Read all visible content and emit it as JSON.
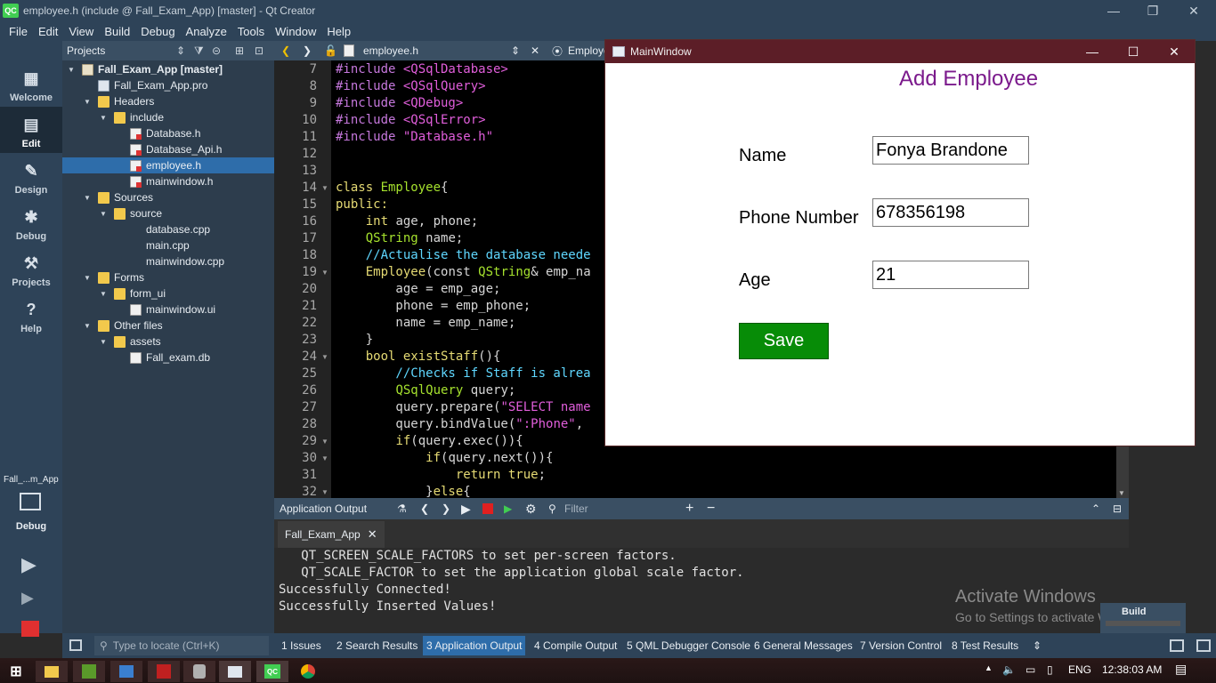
{
  "window": {
    "title": "employee.h (include @ Fall_Exam_App) [master] - Qt Creator",
    "logo": "QC"
  },
  "menu": [
    "File",
    "Edit",
    "View",
    "Build",
    "Debug",
    "Analyze",
    "Tools",
    "Window",
    "Help"
  ],
  "modes": [
    {
      "label": "Welcome",
      "icon": "grid-icon"
    },
    {
      "label": "Edit",
      "icon": "edit-icon"
    },
    {
      "label": "Design",
      "icon": "pen-icon"
    },
    {
      "label": "Debug",
      "icon": "bug-icon"
    },
    {
      "label": "Projects",
      "icon": "wrench-icon"
    },
    {
      "label": "Help",
      "icon": "help-icon"
    }
  ],
  "kit": {
    "project": "Fall_...m_App",
    "mode": "Debug"
  },
  "projects_pane": {
    "title": "Projects",
    "tree": [
      {
        "label": "Fall_Exam_App [master]",
        "type": "proj",
        "arrow": "▼",
        "bold": true
      },
      {
        "label": "Fall_Exam_App.pro",
        "type": "pro",
        "arrow": ""
      },
      {
        "label": "Headers",
        "type": "folder",
        "arrow": "▼"
      },
      {
        "label": "include",
        "type": "folder",
        "arrow": "▼"
      },
      {
        "label": "Database.h",
        "type": "h",
        "arrow": ""
      },
      {
        "label": "Database_Api.h",
        "type": "h",
        "arrow": ""
      },
      {
        "label": "employee.h",
        "type": "h",
        "arrow": "",
        "selected": true
      },
      {
        "label": "mainwindow.h",
        "type": "h",
        "arrow": ""
      },
      {
        "label": "Sources",
        "type": "src",
        "arrow": "▼"
      },
      {
        "label": "source",
        "type": "folder",
        "arrow": "▼"
      },
      {
        "label": "database.cpp",
        "type": "cpp",
        "arrow": ""
      },
      {
        "label": "main.cpp",
        "type": "cpp",
        "arrow": ""
      },
      {
        "label": "mainwindow.cpp",
        "type": "cpp",
        "arrow": ""
      },
      {
        "label": "Forms",
        "type": "forms",
        "arrow": "▼"
      },
      {
        "label": "form_ui",
        "type": "folder",
        "arrow": "▼"
      },
      {
        "label": "mainwindow.ui",
        "type": "ui",
        "arrow": ""
      },
      {
        "label": "Other files",
        "type": "other",
        "arrow": "▼"
      },
      {
        "label": "assets",
        "type": "folder",
        "arrow": "▼"
      },
      {
        "label": "Fall_exam.db",
        "type": "db",
        "arrow": ""
      }
    ]
  },
  "editor": {
    "file": "employee.h",
    "symbol": "Employe",
    "lines": [
      {
        "n": "7",
        "fold": "",
        "seg": [
          [
            "#include ",
            "#c678dd"
          ],
          [
            "<QSqlDatabase>",
            "#e15edb"
          ]
        ]
      },
      {
        "n": "8",
        "fold": "",
        "seg": [
          [
            "#include ",
            "#c678dd"
          ],
          [
            "<QSqlQuery>",
            "#e15edb"
          ]
        ]
      },
      {
        "n": "9",
        "fold": "",
        "seg": [
          [
            "#include ",
            "#c678dd"
          ],
          [
            "<QDebug>",
            "#e15edb"
          ]
        ]
      },
      {
        "n": "10",
        "fold": "",
        "seg": [
          [
            "#include ",
            "#c678dd"
          ],
          [
            "<QSqlError>",
            "#e15edb"
          ]
        ]
      },
      {
        "n": "11",
        "fold": "",
        "seg": [
          [
            "#include ",
            "#c678dd"
          ],
          [
            "\"Database.h\"",
            "#e15edb"
          ]
        ]
      },
      {
        "n": "12",
        "fold": "",
        "seg": []
      },
      {
        "n": "13",
        "fold": "",
        "seg": []
      },
      {
        "n": "14",
        "fold": "▼",
        "seg": [
          [
            "class ",
            "#e6db74"
          ],
          [
            "Employee",
            "#a6e22e"
          ],
          [
            "{",
            "#d6d6d6"
          ]
        ]
      },
      {
        "n": "15",
        "fold": "",
        "seg": [
          [
            "public:",
            "#e6db74"
          ]
        ]
      },
      {
        "n": "16",
        "fold": "",
        "seg": [
          [
            "    ",
            "#d6d6d6"
          ],
          [
            "int ",
            "#e6db74"
          ],
          [
            "age, phone;",
            "#d6d6d6"
          ]
        ]
      },
      {
        "n": "17",
        "fold": "",
        "seg": [
          [
            "    ",
            "#d6d6d6"
          ],
          [
            "QString ",
            "#a6e22e"
          ],
          [
            "name;",
            "#d6d6d6"
          ]
        ]
      },
      {
        "n": "18",
        "fold": "",
        "seg": [
          [
            "    //Actualise the database neede",
            "#5fd7ff"
          ]
        ]
      },
      {
        "n": "19",
        "fold": "▼",
        "seg": [
          [
            "    ",
            "#d6d6d6"
          ],
          [
            "Employee",
            "#e6db74"
          ],
          [
            "(const ",
            "#d6d6d6"
          ],
          [
            "QString",
            "#a6e22e"
          ],
          [
            "& emp_na",
            "#d6d6d6"
          ]
        ]
      },
      {
        "n": "20",
        "fold": "",
        "seg": [
          [
            "        age = emp_age;",
            "#d6d6d6"
          ]
        ]
      },
      {
        "n": "21",
        "fold": "",
        "seg": [
          [
            "        phone = emp_phone;",
            "#d6d6d6"
          ]
        ]
      },
      {
        "n": "22",
        "fold": "",
        "seg": [
          [
            "        name = emp_name;",
            "#d6d6d6"
          ]
        ]
      },
      {
        "n": "23",
        "fold": "",
        "seg": [
          [
            "    }",
            "#d6d6d6"
          ]
        ]
      },
      {
        "n": "24",
        "fold": "▼",
        "seg": [
          [
            "    ",
            "#d6d6d6"
          ],
          [
            "bool ",
            "#e6db74"
          ],
          [
            "existStaff",
            "#e6db74"
          ],
          [
            "(){",
            "#d6d6d6"
          ]
        ]
      },
      {
        "n": "25",
        "fold": "",
        "seg": [
          [
            "        //Checks if Staff is alrea",
            "#5fd7ff"
          ]
        ]
      },
      {
        "n": "26",
        "fold": "",
        "seg": [
          [
            "        ",
            "#d6d6d6"
          ],
          [
            "QSqlQuery ",
            "#a6e22e"
          ],
          [
            "query;",
            "#d6d6d6"
          ]
        ]
      },
      {
        "n": "27",
        "fold": "",
        "seg": [
          [
            "        query.prepare(",
            "#d6d6d6"
          ],
          [
            "\"SELECT name",
            "#e15edb"
          ]
        ]
      },
      {
        "n": "28",
        "fold": "",
        "seg": [
          [
            "        query.bindValue(",
            "#d6d6d6"
          ],
          [
            "\":Phone\"",
            "#e15edb"
          ],
          [
            ",",
            "#d6d6d6"
          ]
        ]
      },
      {
        "n": "29",
        "fold": "▼",
        "seg": [
          [
            "        ",
            "#d6d6d6"
          ],
          [
            "if",
            "#e6db74"
          ],
          [
            "(query.exec()){",
            "#d6d6d6"
          ]
        ]
      },
      {
        "n": "30",
        "fold": "▼",
        "seg": [
          [
            "            ",
            "#d6d6d6"
          ],
          [
            "if",
            "#e6db74"
          ],
          [
            "(query.next()){",
            "#d6d6d6"
          ]
        ]
      },
      {
        "n": "31",
        "fold": "",
        "seg": [
          [
            "                ",
            "#d6d6d6"
          ],
          [
            "return ",
            "#e6db74"
          ],
          [
            "true",
            "#e6db74"
          ],
          [
            ";",
            "#d6d6d6"
          ]
        ]
      },
      {
        "n": "32",
        "fold": "▼",
        "seg": [
          [
            "            }",
            "#d6d6d6"
          ],
          [
            "else",
            "#e6db74"
          ],
          [
            "{",
            "#d6d6d6"
          ]
        ]
      }
    ]
  },
  "output": {
    "pane_title": "Application Output",
    "filter_placeholder": "Filter",
    "tab": "Fall_Exam_App",
    "lines": [
      "   QT_SCREEN_SCALE_FACTORS to set per-screen factors.",
      "   QT_SCALE_FACTOR to set the application global scale factor.",
      "Successfully Connected!",
      "Successfully Inserted Values!"
    ]
  },
  "statusbar": {
    "locate_placeholder": "Type to locate (Ctrl+K)",
    "tabs": [
      "1  Issues",
      "2  Search Results",
      "3  Application Output",
      "4  Compile Output",
      "5  QML Debugger Console",
      "6  General Messages",
      "7  Version Control",
      "8  Test Results"
    ]
  },
  "watermark": {
    "line1": "Activate Windows",
    "line2": "Go to Settings to activate Windows."
  },
  "build_box": {
    "label": "Build"
  },
  "taskbar": {
    "lang": "ENG",
    "time": "12:38:03 AM"
  },
  "dialog": {
    "title": "MainWindow",
    "heading": "Add Employee",
    "fields": [
      {
        "label": "Name",
        "value": "Fonya Brandone"
      },
      {
        "label": "Phone Number",
        "value": "678356198"
      },
      {
        "label": "Age",
        "value": "21"
      }
    ],
    "save_label": "Save"
  }
}
